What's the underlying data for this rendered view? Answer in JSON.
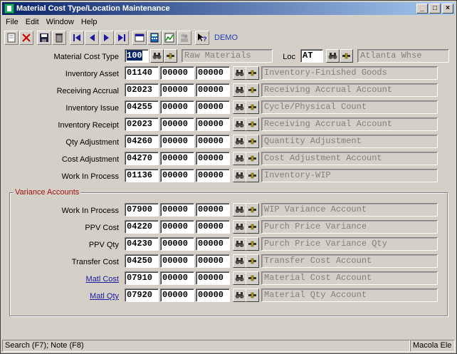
{
  "window": {
    "title": "Material Cost Type/Location Maintenance"
  },
  "menu": [
    "File",
    "Edit",
    "Window",
    "Help"
  ],
  "toolbar": {
    "demo_label": "DEMO"
  },
  "header": {
    "cost_type_label": "Material Cost Type",
    "cost_type_value": "100",
    "cost_type_desc": "Raw Materials",
    "loc_label": "Loc",
    "loc_value": "AT",
    "loc_desc": "Atlanta Whse"
  },
  "rows": [
    {
      "label": "Inventory Asset",
      "a": "01140",
      "b": "00000",
      "c": "00000",
      "desc": "Inventory-Finished Goods"
    },
    {
      "label": "Receiving Accrual",
      "a": "02023",
      "b": "00000",
      "c": "00000",
      "desc": "Receiving Accrual Account"
    },
    {
      "label": "Inventory Issue",
      "a": "04255",
      "b": "00000",
      "c": "00000",
      "desc": "Cycle/Physical Count"
    },
    {
      "label": "Inventory Receipt",
      "a": "02023",
      "b": "00000",
      "c": "00000",
      "desc": "Receiving Accrual Account"
    },
    {
      "label": "Qty Adjustment",
      "a": "04260",
      "b": "00000",
      "c": "00000",
      "desc": "Quantity Adjustment"
    },
    {
      "label": "Cost Adjustment",
      "a": "04270",
      "b": "00000",
      "c": "00000",
      "desc": "Cost Adjustment Account"
    },
    {
      "label": "Work In Process",
      "a": "01136",
      "b": "00000",
      "c": "00000",
      "desc": "Inventory-WIP"
    }
  ],
  "variance": {
    "group_label": "Variance Accounts",
    "rows": [
      {
        "label": "Work In Process",
        "a": "07900",
        "b": "00000",
        "c": "00000",
        "desc": "WIP Variance Account"
      },
      {
        "label": "PPV Cost",
        "a": "04220",
        "b": "00000",
        "c": "00000",
        "desc": "Purch Price Variance"
      },
      {
        "label": "PPV Qty",
        "a": "04230",
        "b": "00000",
        "c": "00000",
        "desc": "Purch Price Variance Qty"
      },
      {
        "label": "Transfer Cost",
        "a": "04250",
        "b": "00000",
        "c": "00000",
        "desc": "Transfer Cost Account"
      },
      {
        "label": "Matl Cost",
        "a": "07910",
        "b": "00000",
        "c": "00000",
        "desc": "Material Cost Account"
      },
      {
        "label": "Matl Qty",
        "a": "07920",
        "b": "00000",
        "c": "00000",
        "desc": "Material Qty Account"
      }
    ]
  },
  "status": {
    "hint": "Search (F7); Note (F8)",
    "user": "Macola Ele"
  }
}
